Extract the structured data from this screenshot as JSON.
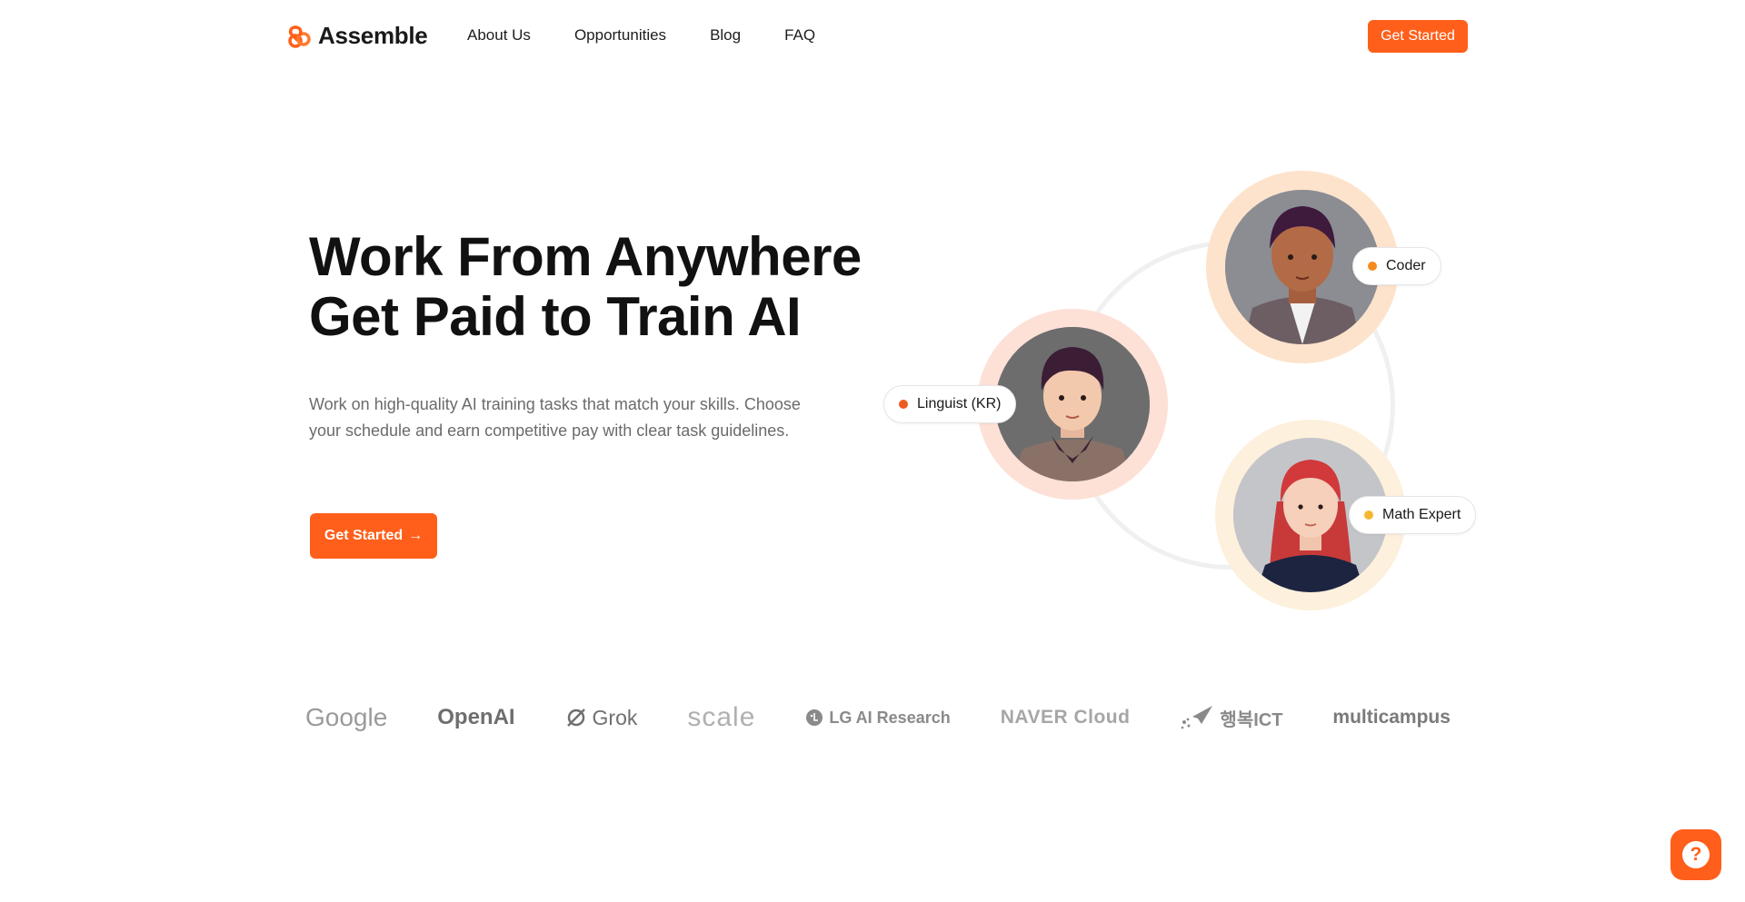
{
  "header": {
    "logo_text": "Assemble",
    "nav": [
      {
        "label": "About Us"
      },
      {
        "label": "Opportunities"
      },
      {
        "label": "Blog"
      },
      {
        "label": "FAQ"
      }
    ],
    "cta_label": "Get Started"
  },
  "hero": {
    "title_line1": "Work From Anywhere",
    "title_line2": "Get Paid to Train AI",
    "description": "Work on high-quality AI training tasks that match your skills. Choose your schedule and earn competitive pay with clear task guidelines.",
    "cta_label": "Get Started",
    "cta_arrow": "→"
  },
  "illustration": {
    "tags": [
      {
        "label": "Coder",
        "dot_color": "#f58a1f"
      },
      {
        "label": "Linguist (KR)",
        "dot_color": "#ef5a1f"
      },
      {
        "label": "Math Expert",
        "dot_color": "#f5b731"
      }
    ]
  },
  "partners": [
    {
      "name": "Google"
    },
    {
      "name": "OpenAI"
    },
    {
      "name": "Grok"
    },
    {
      "name": "scale"
    },
    {
      "name": "LG AI Research"
    },
    {
      "name": "NAVER Cloud"
    },
    {
      "name": "행복ICT"
    },
    {
      "name": "multicampus"
    }
  ],
  "help": {
    "icon": "question-icon",
    "glyph": "?"
  },
  "colors": {
    "accent": "#ff5f1a",
    "text": "#111111",
    "muted": "#6b6b6b"
  }
}
